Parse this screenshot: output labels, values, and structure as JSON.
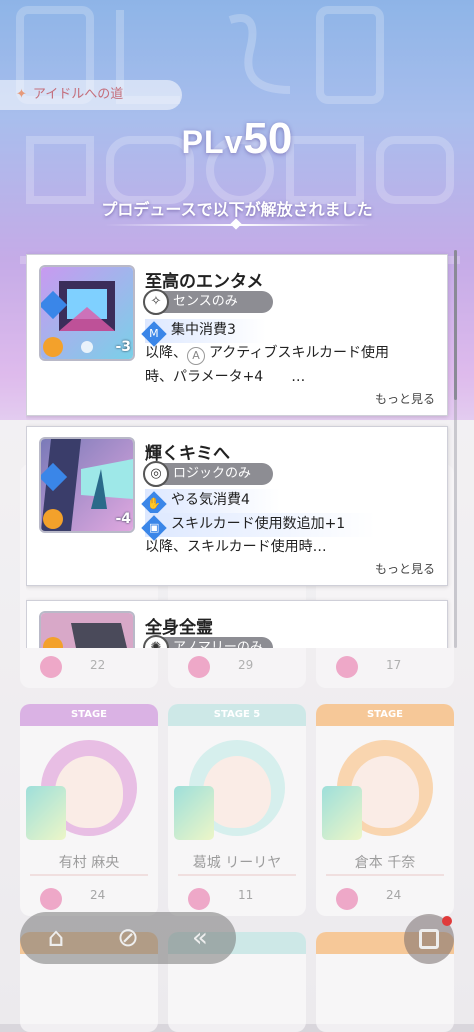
{
  "header": {
    "chip_label": "アイドルへの道",
    "plv_prefix": "PLv",
    "plv_level": "50",
    "unlock_message": "プロデュースで以下が解放されました"
  },
  "cards": [
    {
      "name": "至高のエンタメ",
      "only_label": "センスのみ",
      "cost": "-3",
      "effect1": "集中消費3",
      "desc_line1_prefix": "以降、",
      "desc_line1_rest": "アクティブスキルカード使用",
      "desc_line2": "時、パラメータ+4　　…",
      "more": "もっと見る"
    },
    {
      "name": "輝くキミへ",
      "only_label": "ロジックのみ",
      "cost": "-4",
      "effect1": "やる気消費4",
      "effect2": "スキルカード使用数追加+1",
      "desc_line1": "以降、スキルカード使用時…",
      "more": "もっと見る"
    },
    {
      "name": "全身全霊",
      "only_label": "アノマリーのみ"
    }
  ],
  "background": {
    "row1_values": [
      "22",
      "29",
      "17"
    ],
    "stage_labels": [
      "STAGE",
      "STAGE 5",
      "STAGE"
    ],
    "idol_names": [
      "有村 麻央",
      "葛城 リーリヤ",
      "倉本 千奈"
    ],
    "row2_values": [
      "24",
      "11",
      "24"
    ]
  },
  "icons": {
    "chip_icon": "star-icon",
    "nav": [
      "home-icon",
      "gacha-icon",
      "back-icon"
    ],
    "menu": "menu-icon"
  },
  "colors": {
    "stage_pink": "#c07bd0",
    "stage_teal": "#a9d7d6",
    "stage_orange": "#f0a14f"
  }
}
